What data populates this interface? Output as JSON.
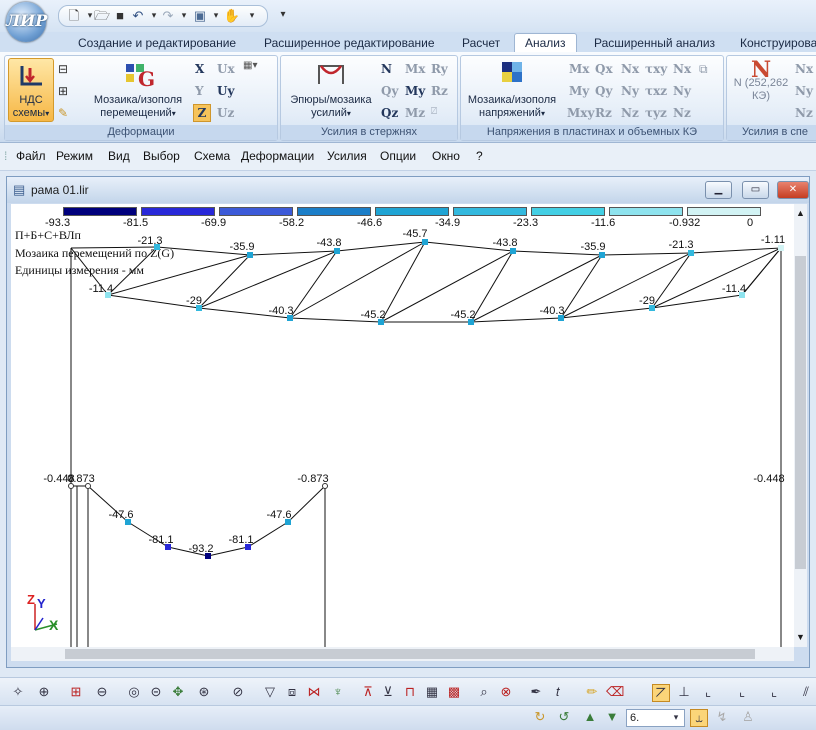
{
  "app": {
    "logo_text": "ЛИР"
  },
  "qat": {
    "icons": [
      "new-file-icon",
      "chevron-down-icon",
      "open-file-icon",
      "save-icon",
      "undo-icon",
      "chevron-down-icon",
      "redo-icon",
      "chevron-down-icon",
      "cube-icon",
      "chevron-down-icon",
      "hand-icon",
      "chevron-down-icon",
      "customize-icon"
    ]
  },
  "tabs": [
    "Создание и редактирование",
    "Расширенное редактирование",
    "Расчет",
    "Анализ",
    "Расширенный анализ",
    "Конструирова"
  ],
  "active_tab": "Анализ",
  "ribbon": {
    "groups": [
      {
        "label": "Деформации",
        "big_buttons": [
          "НДС\nсхемы",
          "Мозаика/изополя\nперемещений"
        ]
      },
      {
        "label": "Усилия в стержнях",
        "big_buttons": [
          "Эпюры/мозаика\nусилий"
        ]
      },
      {
        "label": "Напряжения в пластинах и объемных КЭ",
        "big_buttons": [
          "Мозаика/изополя\nнапряжений"
        ]
      },
      {
        "label": "Усилия в спе",
        "big_buttons": [
          "N (252,262\nКЭ)"
        ]
      }
    ],
    "ndc_label_1": "НДС",
    "ndc_label_2": "схемы",
    "mosaic_disp_1": "Мозаика/изополя",
    "mosaic_disp_2": "перемещений",
    "epures_1": "Эпюры/мозаика",
    "epures_2": "усилий",
    "mosaic_stress_1": "Мозаика/изополя",
    "mosaic_stress_2": "напряжений",
    "n_btn_1": "N (252,262",
    "n_btn_2": "КЭ)",
    "deform_axes": [
      "X",
      "Ux",
      "Y",
      "Uy",
      "Z",
      "Uz"
    ],
    "rod_forces": [
      "N",
      "Mx",
      "Ry",
      "Qy",
      "My",
      "Rz",
      "Qz",
      "Mz"
    ],
    "plate_stress": [
      "Mx",
      "Qx",
      "Nx",
      "τxy",
      "Nx",
      "My",
      "Qy",
      "Ny",
      "τxz",
      "Ny",
      "Mxy",
      "Rz",
      "Nz",
      "τyz",
      "Nz"
    ],
    "spec_forces": [
      "Nx",
      "Ny",
      "Nz"
    ]
  },
  "menu": [
    "Файл",
    "Режим",
    "Вид",
    "Выбор",
    "Схема",
    "Деформации",
    "Усилия",
    "Опции",
    "Окно",
    "?"
  ],
  "document": {
    "title": "рама 01.lir",
    "buttons": [
      "minimize",
      "restore",
      "close"
    ]
  },
  "legend": {
    "values": [
      "-93.3",
      "-81.5",
      "-69.9",
      "-58.2",
      "-46.6",
      "-34.9",
      "-23.3",
      "-11.6",
      "-0.932",
      "0"
    ],
    "colors": [
      "#00007c",
      "#2828d8",
      "#3c5ad8",
      "#1b7ec8",
      "#1fa4d4",
      "#33b9de",
      "#43cfe4",
      "#8ee3ee",
      "#d2f3f4"
    ]
  },
  "info": {
    "load_case": "П+Б+С+ВЛп",
    "mode": "Мозаика перемещений по Z(G)",
    "units": "Единицы измерения - мм"
  },
  "truss": {
    "top_chord": [
      "-21.3",
      "-35.9",
      "-43.8",
      "-45.7",
      "-43.8",
      "-35.9",
      "-21.3",
      "-1.11"
    ],
    "bottom_chord": [
      "-11.4",
      "-29",
      "-40.3",
      "-45.2",
      "-45.2",
      "-40.3",
      "-29",
      "-11.4"
    ]
  },
  "lower": {
    "left_col": [
      "-0.448",
      "0.873"
    ],
    "beam": [
      "-47.6",
      "-81.1",
      "-93.2",
      "-81.1",
      "-47.6"
    ],
    "right_col": [
      "-0.873"
    ],
    "far_right": "-0.448"
  },
  "axes": {
    "z": "Z",
    "y": "Y",
    "x": "X"
  },
  "status": {
    "step_value": "6."
  }
}
